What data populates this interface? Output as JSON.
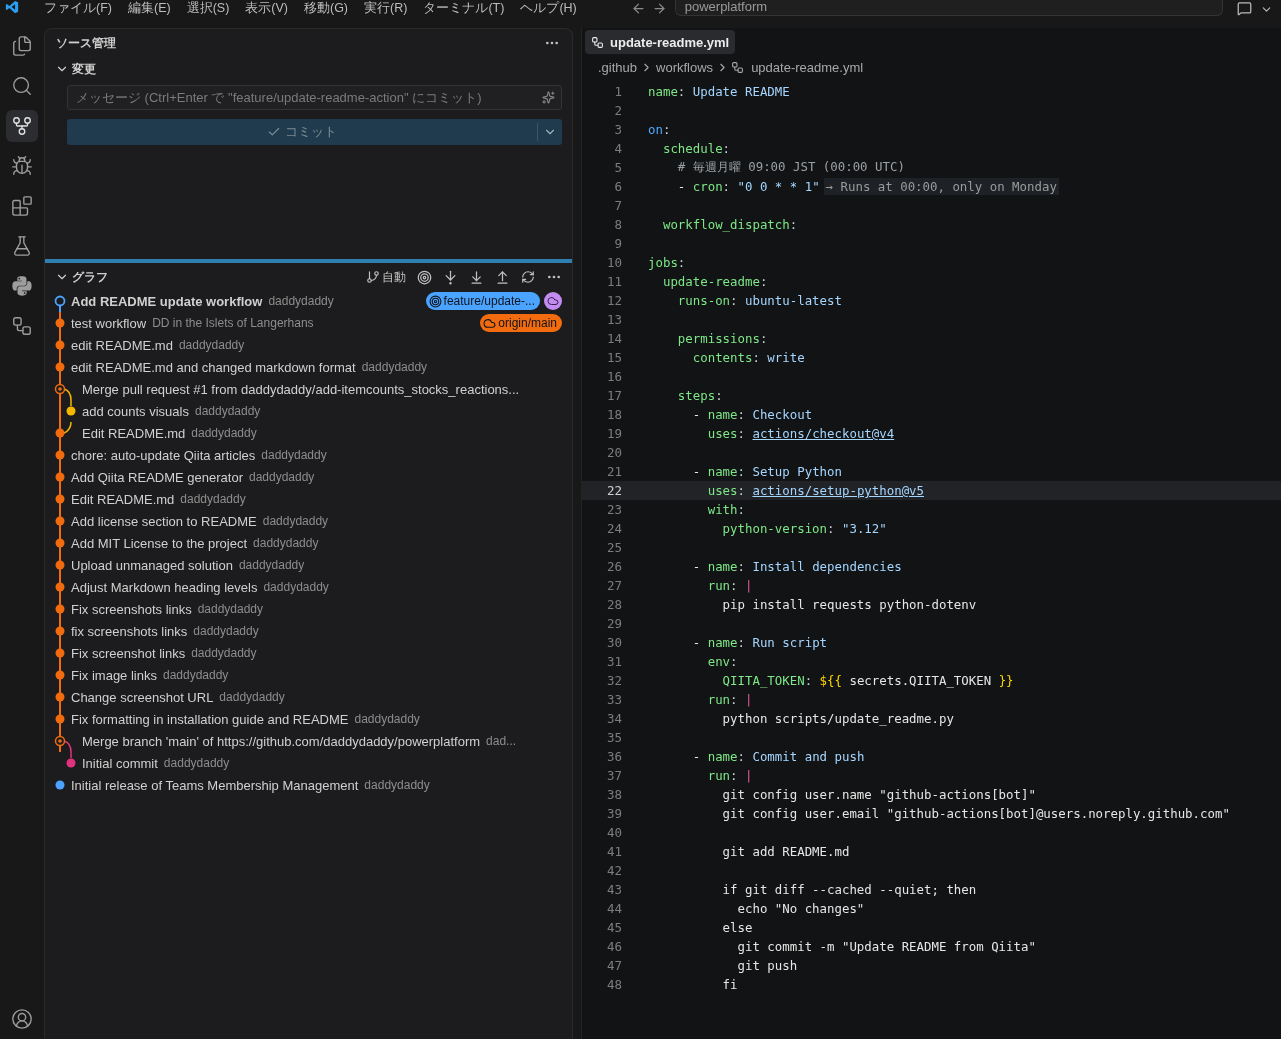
{
  "menu": [
    "ファイル(F)",
    "編集(E)",
    "選択(S)",
    "表示(V)",
    "移動(G)",
    "実行(R)",
    "ターミナル(T)",
    "ヘルプ(H)"
  ],
  "command_center": {
    "value": "powerplatform"
  },
  "activity_bar": [
    {
      "selected": false
    },
    {
      "selected": false
    },
    {
      "selected": true
    },
    {
      "selected": false
    },
    {
      "selected": false
    },
    {
      "selected": false
    },
    {
      "selected": false
    },
    {
      "selected": false
    }
  ],
  "source_control": {
    "title": "ソース管理",
    "changes": {
      "title": "変更",
      "expanded": true
    },
    "message": {
      "placeholder": "メッセージ (Ctrl+Enter で \"feature/update-readme-action\" にコミット)"
    },
    "commit_button": {
      "label": "コミット",
      "disabled": true
    }
  },
  "graph": {
    "title": "グラフ",
    "expanded": true,
    "auto_label": "自動",
    "commits": [
      {
        "kind": "head",
        "message": "Add README update workflow",
        "author": "daddydaddy",
        "bold": true,
        "color": "#4aa3ff",
        "refs": [
          {
            "kind": "branch",
            "label": "feature/update-...",
            "color": "#4aa3ff"
          },
          {
            "kind": "cloud",
            "color": "#c38cf0"
          }
        ]
      },
      {
        "kind": "commit",
        "message": "test workflow",
        "author": "DD in the Islets of Langerhans",
        "bold": false,
        "color": "#f26b0f",
        "refs": [
          {
            "kind": "remote",
            "label": "origin/main",
            "color": "#f26b0f"
          }
        ]
      },
      {
        "kind": "commit",
        "message": "edit README.md",
        "author": "daddydaddy",
        "bold": false,
        "color": "#f26b0f"
      },
      {
        "kind": "commit",
        "message": "edit README.md and changed markdown format",
        "author": "daddydaddy",
        "bold": false,
        "color": "#f26b0f"
      },
      {
        "kind": "merge",
        "message": "Merge pull request #1 from daddydaddy/add-itemcounts_stocks_reactions...",
        "bold": false,
        "color": "#f26b0f"
      },
      {
        "kind": "side",
        "message": "add counts visuals",
        "author": "daddydaddy",
        "bold": false,
        "color": "#f5b800"
      },
      {
        "kind": "join",
        "message": "Edit README.md",
        "author": "daddydaddy",
        "bold": false,
        "color": "#f26b0f"
      },
      {
        "kind": "commit",
        "message": "chore: auto-update Qiita articles",
        "author": "daddydaddy",
        "bold": false,
        "color": "#f26b0f"
      },
      {
        "kind": "commit",
        "message": "Add Qiita README generator",
        "author": "daddydaddy",
        "bold": false,
        "color": "#f26b0f"
      },
      {
        "kind": "commit",
        "message": "Edit README.md",
        "author": "daddydaddy",
        "bold": false,
        "color": "#f26b0f"
      },
      {
        "kind": "commit",
        "message": "Add license section to README",
        "author": "daddydaddy",
        "bold": false,
        "color": "#f26b0f"
      },
      {
        "kind": "commit",
        "message": "Add MIT License to the project",
        "author": "daddydaddy",
        "bold": false,
        "color": "#f26b0f"
      },
      {
        "kind": "commit",
        "message": "Upload unmanaged solution",
        "author": "daddydaddy",
        "bold": false,
        "color": "#f26b0f"
      },
      {
        "kind": "commit",
        "message": "Adjust Markdown heading levels",
        "author": "daddydaddy",
        "bold": false,
        "color": "#f26b0f"
      },
      {
        "kind": "commit",
        "message": "Fix screenshots links",
        "author": "daddydaddy",
        "bold": false,
        "color": "#f26b0f"
      },
      {
        "kind": "commit",
        "message": "fix screenshots links",
        "author": "daddydaddy",
        "bold": false,
        "color": "#f26b0f"
      },
      {
        "kind": "commit",
        "message": "Fix screenshot links",
        "author": "daddydaddy",
        "bold": false,
        "color": "#f26b0f"
      },
      {
        "kind": "commit",
        "message": "Fix image links",
        "author": "daddydaddy",
        "bold": false,
        "color": "#f26b0f"
      },
      {
        "kind": "commit",
        "message": "Change screenshot URL",
        "author": "daddydaddy",
        "bold": false,
        "color": "#f26b0f"
      },
      {
        "kind": "commit",
        "message": "Fix formatting in installation guide and README",
        "author": "daddydaddy",
        "bold": false,
        "color": "#f26b0f"
      },
      {
        "kind": "merge",
        "message": "Merge branch 'main' of https://github.com/daddydaddy/powerplatform",
        "author": "dad...",
        "bold": false,
        "color": "#f26b0f"
      },
      {
        "kind": "side",
        "message": "Initial commit",
        "author": "daddydaddy",
        "bold": false,
        "color": "#e0337e"
      },
      {
        "kind": "root",
        "message": "Initial release of Teams Membership Management",
        "author": "daddydaddy",
        "bold": false,
        "color": "#4aa3ff"
      }
    ]
  },
  "editor": {
    "tab": {
      "label": "update-readme.yml",
      "selected": true
    },
    "breadcrumbs": [
      ".github",
      "workflows",
      "update-readme.yml"
    ],
    "lines": [
      {
        "number": "1",
        "current": false,
        "tokens": [
          {
            "kind": "key",
            "text": "name"
          },
          {
            "kind": "punct",
            "text": ": "
          },
          {
            "kind": "value",
            "text": "Update README"
          }
        ]
      },
      {
        "number": "2",
        "current": false
      },
      {
        "number": "3",
        "current": false,
        "tokens": [
          {
            "kind": "keyword",
            "text": "on"
          },
          {
            "kind": "punct",
            "text": ":"
          }
        ]
      },
      {
        "number": "4",
        "current": false,
        "tokens": [
          {
            "kind": "key",
            "text": "  schedule"
          },
          {
            "kind": "punct",
            "text": ":"
          }
        ]
      },
      {
        "number": "5",
        "current": false,
        "tokens": [
          {
            "kind": "comment",
            "text": "    # 毎週月曜 09:00 JST (00:00 UTC)"
          }
        ]
      },
      {
        "number": "6",
        "current": false,
        "tokens": [
          {
            "kind": "text",
            "text": "    - "
          },
          {
            "kind": "key",
            "text": "cron"
          },
          {
            "kind": "punct",
            "text": ": "
          },
          {
            "kind": "string",
            "text": "\"0 0 * * 1\""
          },
          {
            "kind": "hint",
            "text": "→ Runs at 00:00, only on Monday"
          }
        ]
      },
      {
        "number": "7",
        "current": false
      },
      {
        "number": "8",
        "current": false,
        "tokens": [
          {
            "kind": "key",
            "text": "  workflow_dispatch"
          },
          {
            "kind": "punct",
            "text": ":"
          }
        ]
      },
      {
        "number": "9",
        "current": false
      },
      {
        "number": "10",
        "current": false,
        "tokens": [
          {
            "kind": "key",
            "text": "jobs"
          },
          {
            "kind": "punct",
            "text": ":"
          }
        ]
      },
      {
        "number": "11",
        "current": false,
        "tokens": [
          {
            "kind": "key",
            "text": "  update-readme"
          },
          {
            "kind": "punct",
            "text": ":"
          }
        ]
      },
      {
        "number": "12",
        "current": false,
        "tokens": [
          {
            "kind": "key",
            "text": "    runs-on"
          },
          {
            "kind": "punct",
            "text": ": "
          },
          {
            "kind": "value",
            "text": "ubuntu-latest"
          }
        ]
      },
      {
        "number": "13",
        "current": false
      },
      {
        "number": "14",
        "current": false,
        "tokens": [
          {
            "kind": "key",
            "text": "    permissions"
          },
          {
            "kind": "punct",
            "text": ":"
          }
        ]
      },
      {
        "number": "15",
        "current": false,
        "tokens": [
          {
            "kind": "key",
            "text": "      contents"
          },
          {
            "kind": "punct",
            "text": ": "
          },
          {
            "kind": "value",
            "text": "write"
          }
        ]
      },
      {
        "number": "16",
        "current": false
      },
      {
        "number": "17",
        "current": false,
        "tokens": [
          {
            "kind": "key",
            "text": "    steps"
          },
          {
            "kind": "punct",
            "text": ":"
          }
        ]
      },
      {
        "number": "18",
        "current": false,
        "tokens": [
          {
            "kind": "text",
            "text": "      - "
          },
          {
            "kind": "key",
            "text": "name"
          },
          {
            "kind": "punct",
            "text": ": "
          },
          {
            "kind": "value",
            "text": "Checkout"
          }
        ]
      },
      {
        "number": "19",
        "current": false,
        "tokens": [
          {
            "kind": "key",
            "text": "        uses"
          },
          {
            "kind": "punct",
            "text": ": "
          },
          {
            "kind": "link",
            "text": "actions/checkout@v4"
          }
        ]
      },
      {
        "number": "20",
        "current": false
      },
      {
        "number": "21",
        "current": false,
        "tokens": [
          {
            "kind": "text",
            "text": "      - "
          },
          {
            "kind": "key",
            "text": "name"
          },
          {
            "kind": "punct",
            "text": ": "
          },
          {
            "kind": "value",
            "text": "Setup Python"
          }
        ]
      },
      {
        "number": "22",
        "current": true,
        "tokens": [
          {
            "kind": "key",
            "text": "        uses"
          },
          {
            "kind": "punct",
            "text": ": "
          },
          {
            "kind": "link",
            "text": "actions/setup-python@v5"
          }
        ]
      },
      {
        "number": "23",
        "current": false,
        "tokens": [
          {
            "kind": "key",
            "text": "        with"
          },
          {
            "kind": "punct",
            "text": ":"
          }
        ]
      },
      {
        "number": "24",
        "current": false,
        "tokens": [
          {
            "kind": "key",
            "text": "          python-version"
          },
          {
            "kind": "punct",
            "text": ": "
          },
          {
            "kind": "string",
            "text": "\"3.12\""
          }
        ]
      },
      {
        "number": "25",
        "current": false
      },
      {
        "number": "26",
        "current": false,
        "tokens": [
          {
            "kind": "text",
            "text": "      - "
          },
          {
            "kind": "key",
            "text": "name"
          },
          {
            "kind": "punct",
            "text": ": "
          },
          {
            "kind": "value",
            "text": "Install dependencies"
          }
        ]
      },
      {
        "number": "27",
        "current": false,
        "tokens": [
          {
            "kind": "key",
            "text": "        run"
          },
          {
            "kind": "punct",
            "text": ": "
          },
          {
            "kind": "pipe",
            "text": "|"
          }
        ]
      },
      {
        "number": "28",
        "current": false,
        "tokens": [
          {
            "kind": "text",
            "text": "          pip install requests python-dotenv"
          }
        ]
      },
      {
        "number": "29",
        "current": false
      },
      {
        "number": "30",
        "current": false,
        "tokens": [
          {
            "kind": "text",
            "text": "      - "
          },
          {
            "kind": "key",
            "text": "name"
          },
          {
            "kind": "punct",
            "text": ": "
          },
          {
            "kind": "value",
            "text": "Run script"
          }
        ]
      },
      {
        "number": "31",
        "current": false,
        "tokens": [
          {
            "kind": "key",
            "text": "        env"
          },
          {
            "kind": "punct",
            "text": ":"
          }
        ]
      },
      {
        "number": "32",
        "current": false,
        "tokens": [
          {
            "kind": "key",
            "text": "          QIITA_TOKEN"
          },
          {
            "kind": "punct",
            "text": ": "
          },
          {
            "kind": "expr",
            "text": "${{"
          },
          {
            "kind": "text",
            "text": " secrets.QIITA_TOKEN "
          },
          {
            "kind": "expr",
            "text": "}}"
          }
        ]
      },
      {
        "number": "33",
        "current": false,
        "tokens": [
          {
            "kind": "key",
            "text": "        run"
          },
          {
            "kind": "punct",
            "text": ": "
          },
          {
            "kind": "pipe",
            "text": "|"
          }
        ]
      },
      {
        "number": "34",
        "current": false,
        "tokens": [
          {
            "kind": "text",
            "text": "          python scripts/update_readme.py"
          }
        ]
      },
      {
        "number": "35",
        "current": false
      },
      {
        "number": "36",
        "current": false,
        "tokens": [
          {
            "kind": "text",
            "text": "      - "
          },
          {
            "kind": "key",
            "text": "name"
          },
          {
            "kind": "punct",
            "text": ": "
          },
          {
            "kind": "value",
            "text": "Commit and push"
          }
        ]
      },
      {
        "number": "37",
        "current": false,
        "tokens": [
          {
            "kind": "key",
            "text": "        run"
          },
          {
            "kind": "punct",
            "text": ": "
          },
          {
            "kind": "pipe",
            "text": "|"
          }
        ]
      },
      {
        "number": "38",
        "current": false,
        "tokens": [
          {
            "kind": "text",
            "text": "          git config user.name \"github-actions[bot]\""
          }
        ]
      },
      {
        "number": "39",
        "current": false,
        "tokens": [
          {
            "kind": "text",
            "text": "          git config user.email \"github-actions[bot]@users.noreply.github.com\""
          }
        ]
      },
      {
        "number": "40",
        "current": false
      },
      {
        "number": "41",
        "current": false,
        "tokens": [
          {
            "kind": "text",
            "text": "          git add README.md"
          }
        ]
      },
      {
        "number": "42",
        "current": false
      },
      {
        "number": "43",
        "current": false,
        "tokens": [
          {
            "kind": "text",
            "text": "          if git diff --cached --quiet; then"
          }
        ]
      },
      {
        "number": "44",
        "current": false,
        "tokens": [
          {
            "kind": "text",
            "text": "            echo \"No changes\""
          }
        ]
      },
      {
        "number": "45",
        "current": false,
        "tokens": [
          {
            "kind": "text",
            "text": "          else"
          }
        ]
      },
      {
        "number": "46",
        "current": false,
        "tokens": [
          {
            "kind": "text",
            "text": "            git commit -m \"Update README from Qiita\""
          }
        ]
      },
      {
        "number": "47",
        "current": false,
        "tokens": [
          {
            "kind": "text",
            "text": "            git push"
          }
        ]
      },
      {
        "number": "48",
        "current": false,
        "tokens": [
          {
            "kind": "text",
            "text": "          fi"
          }
        ]
      }
    ]
  }
}
